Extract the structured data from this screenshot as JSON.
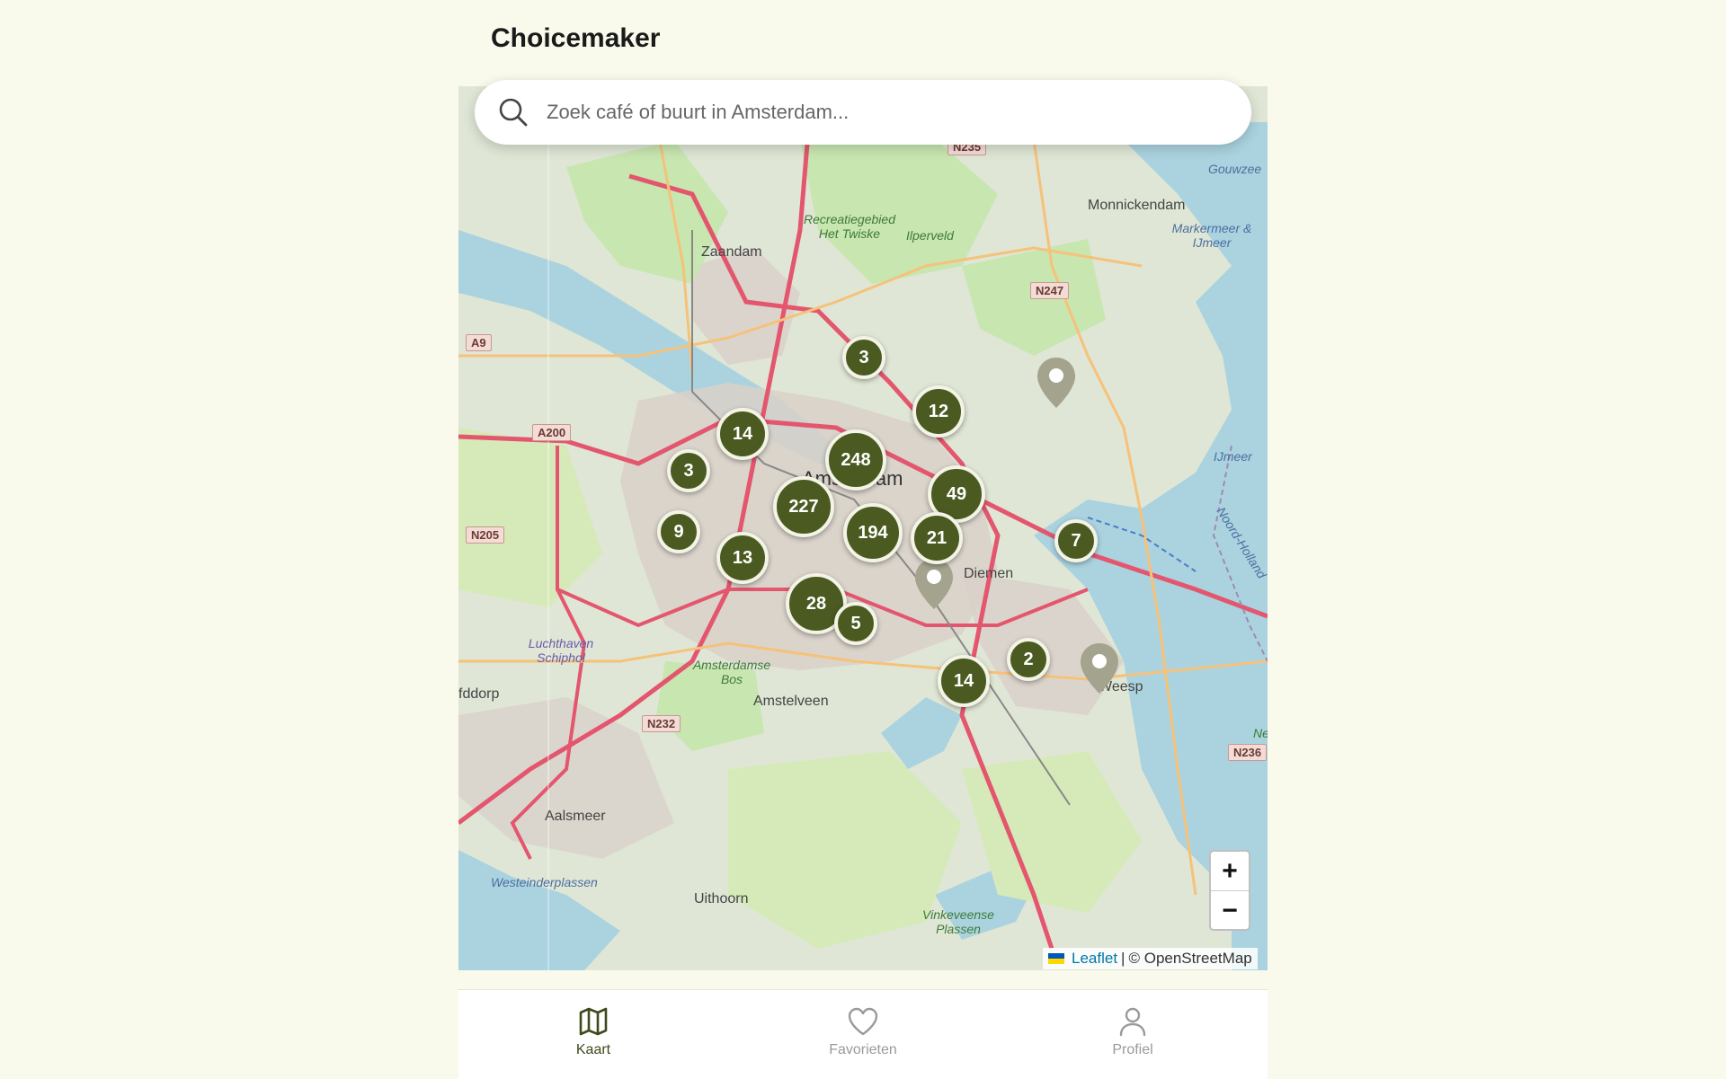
{
  "app": {
    "title": "Choicemaker"
  },
  "search": {
    "placeholder": "Zoek café of buurt in Amsterdam..."
  },
  "map": {
    "place_labels": {
      "zaandam": "Zaandam",
      "amsterdam": "Amsterdam",
      "monnickendam": "Monnickendam",
      "diemen": "Diemen",
      "weesp": "Weesp",
      "amstelveen": "Amstelveen",
      "aalsmeer": "Aalsmeer",
      "uithoorn": "Uithoorn",
      "hoofddorp": "fddorp",
      "gouwzee": "Gouwzee",
      "markermeer": "Markermeer & IJmeer",
      "ijmeer": "IJmeer",
      "noord_holland": "Noord-Holland",
      "recreatiegebied": "Recreatiegebied Het Twiske",
      "ilperveld": "Ilperveld",
      "schiphol": "Luchthaven Schiphol",
      "amsterdamse_bos": "Amsterdamse Bos",
      "westeinderplassen": "Westeinderplassen",
      "vinkeveense": "Vinkeveense Plassen",
      "nl": "Ne"
    },
    "road_shields": {
      "n235": "N235",
      "n247": "N247",
      "a9": "A9",
      "a200": "A200",
      "n205": "N205",
      "n232": "N232",
      "n236": "N236"
    },
    "clusters": {
      "c1": "3",
      "c2": "12",
      "c3": "14",
      "c4": "248",
      "c5": "3",
      "c6": "49",
      "c7": "227",
      "c8": "194",
      "c9": "21",
      "c10": "9",
      "c11": "7",
      "c12": "13",
      "c13": "28",
      "c14": "5",
      "c15": "2",
      "c16": "14"
    },
    "zoom": {
      "in_label": "+",
      "out_label": "−"
    },
    "attribution": {
      "leaflet": "Leaflet",
      "separator": "|",
      "osm": "© OpenStreetMap"
    },
    "colors": {
      "cluster": "#4a5a20",
      "pin": "#a3a38e"
    }
  },
  "nav": {
    "map_label": "Kaart",
    "favorites_label": "Favorieten",
    "profile_label": "Profiel",
    "active_color": "#3d4a1a",
    "inactive_color": "#9a9a9a"
  }
}
